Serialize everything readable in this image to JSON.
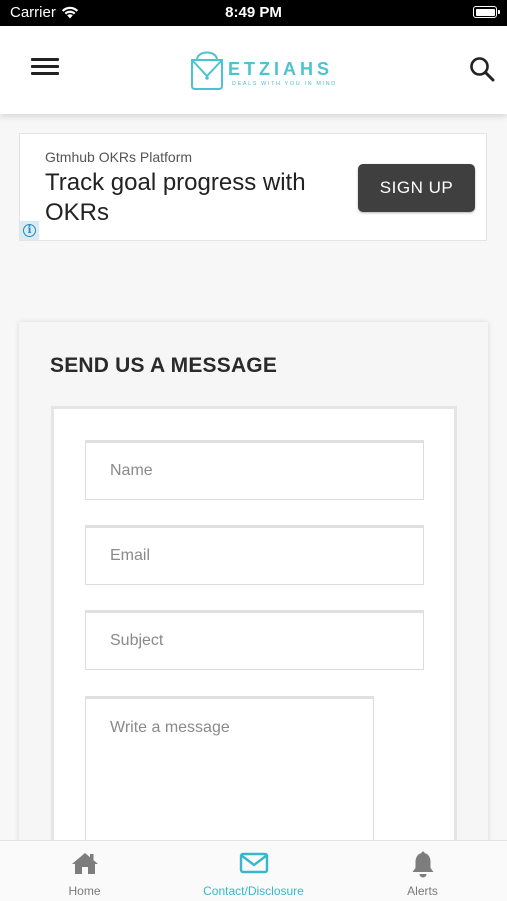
{
  "status_bar": {
    "carrier": "Carrier",
    "time": "8:49 PM"
  },
  "header": {
    "logo_word": "ETZIAHS",
    "logo_tagline": "DEALS WITH YOU IN MIND",
    "brand_color": "#4bc3d1"
  },
  "ad": {
    "sponsor": "Gtmhub OKRs Platform",
    "headline": "Track goal progress with OKRs",
    "cta_label": "SIGN UP"
  },
  "contact_form": {
    "title": "SEND US A MESSAGE",
    "name_placeholder": "Name",
    "email_placeholder": "Email",
    "subject_placeholder": "Subject",
    "message_placeholder": "Write a message"
  },
  "tab_bar": {
    "active_color": "#35b7cc",
    "inactive_color": "#7a7a7a",
    "tabs": [
      {
        "label": "Home",
        "icon": "home-icon"
      },
      {
        "label": "Contact/Disclosure",
        "icon": "envelope-icon"
      },
      {
        "label": "Alerts",
        "icon": "bell-icon"
      }
    ]
  }
}
